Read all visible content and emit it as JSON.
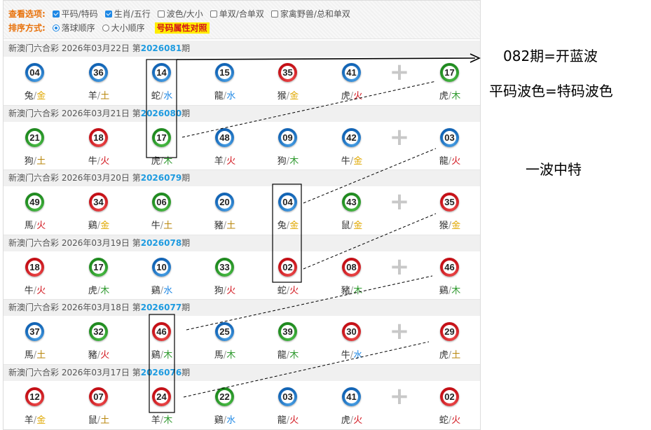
{
  "options": {
    "view_label": "查看选项:",
    "view_options": [
      {
        "label": "平码/特码",
        "checked": true
      },
      {
        "label": "生肖/五行",
        "checked": true
      },
      {
        "label": "波色/大小",
        "checked": false
      },
      {
        "label": "单双/合单双",
        "checked": false
      },
      {
        "label": "家禽野兽/总和单双",
        "checked": false
      }
    ],
    "sort_label": "排序方式:",
    "sort_options": [
      {
        "label": "落球顺序",
        "selected": true
      },
      {
        "label": "大小顺序",
        "selected": false
      }
    ],
    "attr_link": "号码属性对照"
  },
  "draws": [
    {
      "title_prefix": "新澳门六合彩 2026年03月22日 第",
      "issue": "2026081",
      "title_suffix": "期",
      "balls": [
        {
          "num": "04",
          "color": "blue",
          "zodiac": "兔",
          "element": "金"
        },
        {
          "num": "36",
          "color": "blue",
          "zodiac": "羊",
          "element": "土"
        },
        {
          "num": "14",
          "color": "blue",
          "zodiac": "蛇",
          "element": "水"
        },
        {
          "num": "15",
          "color": "blue",
          "zodiac": "龍",
          "element": "水"
        },
        {
          "num": "35",
          "color": "red",
          "zodiac": "猴",
          "element": "金"
        },
        {
          "num": "41",
          "color": "blue",
          "zodiac": "虎",
          "element": "火"
        },
        {
          "num": "17",
          "color": "green",
          "zodiac": "虎",
          "element": "木"
        }
      ]
    },
    {
      "title_prefix": "新澳门六合彩 2026年03月21日 第",
      "issue": "2026080",
      "title_suffix": "期",
      "balls": [
        {
          "num": "21",
          "color": "green",
          "zodiac": "狗",
          "element": "土"
        },
        {
          "num": "18",
          "color": "red",
          "zodiac": "牛",
          "element": "火"
        },
        {
          "num": "17",
          "color": "green",
          "zodiac": "虎",
          "element": "木"
        },
        {
          "num": "48",
          "color": "blue",
          "zodiac": "羊",
          "element": "火"
        },
        {
          "num": "09",
          "color": "blue",
          "zodiac": "狗",
          "element": "木"
        },
        {
          "num": "42",
          "color": "blue",
          "zodiac": "牛",
          "element": "金"
        },
        {
          "num": "03",
          "color": "blue",
          "zodiac": "龍",
          "element": "火"
        }
      ]
    },
    {
      "title_prefix": "新澳门六合彩 2026年03月20日 第",
      "issue": "2026079",
      "title_suffix": "期",
      "balls": [
        {
          "num": "49",
          "color": "green",
          "zodiac": "馬",
          "element": "火"
        },
        {
          "num": "34",
          "color": "red",
          "zodiac": "鷄",
          "element": "金"
        },
        {
          "num": "06",
          "color": "green",
          "zodiac": "牛",
          "element": "土"
        },
        {
          "num": "20",
          "color": "blue",
          "zodiac": "豬",
          "element": "土"
        },
        {
          "num": "04",
          "color": "blue",
          "zodiac": "兔",
          "element": "金"
        },
        {
          "num": "43",
          "color": "green",
          "zodiac": "鼠",
          "element": "金"
        },
        {
          "num": "35",
          "color": "red",
          "zodiac": "猴",
          "element": "金"
        }
      ]
    },
    {
      "title_prefix": "新澳门六合彩 2026年03月19日 第",
      "issue": "2026078",
      "title_suffix": "期",
      "balls": [
        {
          "num": "18",
          "color": "red",
          "zodiac": "牛",
          "element": "火"
        },
        {
          "num": "17",
          "color": "green",
          "zodiac": "虎",
          "element": "木"
        },
        {
          "num": "10",
          "color": "blue",
          "zodiac": "鷄",
          "element": "水"
        },
        {
          "num": "33",
          "color": "green",
          "zodiac": "狗",
          "element": "火"
        },
        {
          "num": "02",
          "color": "red",
          "zodiac": "蛇",
          "element": "火"
        },
        {
          "num": "08",
          "color": "red",
          "zodiac": "豬",
          "element": "木"
        },
        {
          "num": "46",
          "color": "red",
          "zodiac": "鷄",
          "element": "木"
        }
      ]
    },
    {
      "title_prefix": "新澳门六合彩 2026年03月18日 第",
      "issue": "2026077",
      "title_suffix": "期",
      "balls": [
        {
          "num": "37",
          "color": "blue",
          "zodiac": "馬",
          "element": "土"
        },
        {
          "num": "32",
          "color": "green",
          "zodiac": "豬",
          "element": "火"
        },
        {
          "num": "46",
          "color": "red",
          "zodiac": "鷄",
          "element": "木"
        },
        {
          "num": "25",
          "color": "blue",
          "zodiac": "馬",
          "element": "木"
        },
        {
          "num": "39",
          "color": "green",
          "zodiac": "龍",
          "element": "木"
        },
        {
          "num": "30",
          "color": "red",
          "zodiac": "牛",
          "element": "水"
        },
        {
          "num": "29",
          "color": "red",
          "zodiac": "虎",
          "element": "土"
        }
      ]
    },
    {
      "title_prefix": "新澳门六合彩 2026年03月17日 第",
      "issue": "2026076",
      "title_suffix": "期",
      "balls": [
        {
          "num": "12",
          "color": "red",
          "zodiac": "羊",
          "element": "金"
        },
        {
          "num": "07",
          "color": "red",
          "zodiac": "鼠",
          "element": "土"
        },
        {
          "num": "24",
          "color": "red",
          "zodiac": "羊",
          "element": "木"
        },
        {
          "num": "22",
          "color": "green",
          "zodiac": "鷄",
          "element": "水"
        },
        {
          "num": "03",
          "color": "blue",
          "zodiac": "龍",
          "element": "火"
        },
        {
          "num": "41",
          "color": "blue",
          "zodiac": "虎",
          "element": "火"
        },
        {
          "num": "02",
          "color": "red",
          "zodiac": "蛇",
          "element": "火"
        }
      ]
    }
  ],
  "separator_icon": "plus-icon",
  "annotations": {
    "next": "082期=开蓝波",
    "rule": "平码波色=特码波色",
    "pattern": "一波中特"
  },
  "colors": {
    "red": "#c40f16",
    "blue": "#1264b5",
    "green": "#1f8a1f",
    "issue": "#1e9be0",
    "option_label": "#e8720c"
  }
}
